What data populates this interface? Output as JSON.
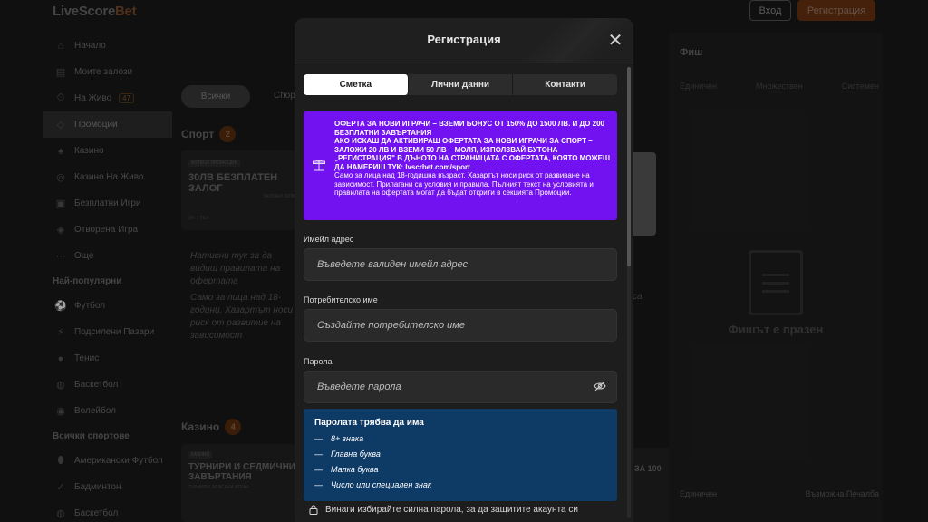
{
  "header": {
    "logo_main": "LiveScore",
    "logo_accent": "Bet",
    "login_label": "Вход",
    "register_label": "Регистрация"
  },
  "sidebar": {
    "items": [
      {
        "label": "Начало",
        "icon": "home-icon"
      },
      {
        "label": "Моите залози",
        "icon": "bets-icon"
      },
      {
        "label": "На Живо",
        "icon": "live-icon",
        "badge": "47"
      },
      {
        "label": "Промоции",
        "icon": "promo-icon",
        "active": true
      },
      {
        "label": "Казино",
        "icon": "casino-icon"
      },
      {
        "label": "Казино На Живо",
        "icon": "live-casino-icon"
      },
      {
        "label": "Безплатни Игри",
        "icon": "free-games-icon"
      },
      {
        "label": "Отворена Игра",
        "icon": "open-game-icon"
      },
      {
        "label": "Още",
        "icon": "more-icon"
      }
    ],
    "popular_heading": "Най-популярни",
    "popular": [
      {
        "label": "Футбол",
        "icon": "football-icon"
      },
      {
        "label": "Подсилени Пазари",
        "icon": "boost-icon"
      },
      {
        "label": "Тенис",
        "icon": "tennis-icon"
      },
      {
        "label": "Баскетбол",
        "icon": "basketball-icon"
      },
      {
        "label": "Волейбол",
        "icon": "volleyball-icon"
      }
    ],
    "all_sports_heading": "Всички спортове",
    "all_sports": [
      {
        "label": "Американски Футбол",
        "icon": "american-football-icon"
      },
      {
        "label": "Бадминтон",
        "icon": "badminton-icon"
      },
      {
        "label": "Баскетбол",
        "icon": "basketball-icon"
      }
    ]
  },
  "main": {
    "tab_all": "Всички",
    "tab_sport": "Спор",
    "sport_title": "Спорт",
    "sport_count": "2",
    "promo_tag": "ФУТБОЛ ПРОМОЦИЯ",
    "promo_head": "30ЛВ БЕЗПЛАТЕН ЗАЛОГ",
    "promo_sub": "ЗАЛОЖИ 30ЛВ",
    "promo_meta": "18+ | Т&У",
    "promo_text_1": "Натисни тук за да видиш правилата на офертата",
    "promo_text_2": "Само за лица над 18-години. Хазартът носи риск от развитие на зависимост",
    "casino_title": "Казино",
    "casino_count": "4",
    "casino_tag": "КАЗИНО",
    "casino_head": "ТУРНИРИ И СЕДМИЧНИ ЗАВЪРТАНИЯ",
    "casino_sub": "ТУРНИРИ ЗА ВСЕКИ ИГРАЧ",
    "right_head": "ЗА 100",
    "right_co": "са"
  },
  "betslip": {
    "title": "Фиш",
    "tabs": [
      "Единичен",
      "Множествен",
      "Системен"
    ],
    "empty": "Фишът е празен",
    "footer_left": "Единичен",
    "footer_right": "Възможна Печалба"
  },
  "modal": {
    "title": "Регистрация",
    "tabs": [
      "Сметка",
      "Лични данни",
      "Контакти"
    ],
    "offer_bold": "ОФЕРТА ЗА НОВИ ИГРАЧИ – ВЗЕМИ БОНУС ОТ 150% ДО 1500 ЛВ. И ДО 200 БЕЗПЛАТНИ ЗАВЪРТАНИЯ",
    "offer_bold_2": "АКО ИСКАШ ДА АКТИВИРАШ ОФЕРТАТА ЗА НОВИ ИГРАЧИ ЗА СПОРТ – ЗАЛОЖИ 20 ЛВ И ВЗЕМИ 50 ЛВ – МОЛЯ, ИЗПОЛЗВАЙ БУТОНА „РЕГИСТРАЦИЯ\" В ДЪНОТО НА СТРАНИЦАТА С ОФЕРТАТА, КОЯТО МОЖЕШ ДА НАМЕРИШ ТУК: lvscrbet.com/sport",
    "offer_small": "Само за лица над 18-годишна възраст. Хазартът носи риск от развиване на зависимост. Прилагани са условия и правила. Пълният текст на условията и правилата на офертата могат да бъдат открити в секцията Промоции.",
    "email_label": "Имейл адрес",
    "email_placeholder": "Въведете валиден имейл адрес",
    "username_label": "Потребителско име",
    "username_placeholder": "Създайте потребителско име",
    "password_label": "Парола",
    "password_placeholder": "Въведете парола",
    "rules_title": "Паролата трябва да има",
    "rules": [
      "8+ знака",
      "Главна буква",
      "Малка буква",
      "Число или специален знак"
    ],
    "hint": "Винаги избирайте силна парола, за да защитите акаунта си"
  },
  "colors": {
    "offer_bg": "#7312f0",
    "rules_bg": "#0e3a66",
    "brand_orange": "#6a3210"
  }
}
